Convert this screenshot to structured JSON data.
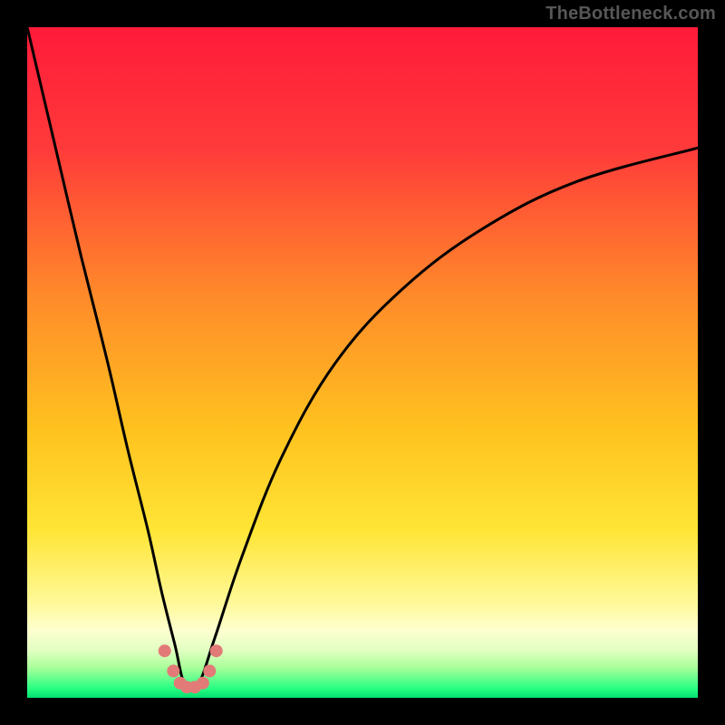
{
  "watermark": "TheBottleneck.com",
  "frame": {
    "outer_w": 800,
    "outer_h": 800,
    "border": 30
  },
  "gradient": {
    "stops": [
      {
        "offset": 0.0,
        "color": "#ff1a3a"
      },
      {
        "offset": 0.18,
        "color": "#ff3a3a"
      },
      {
        "offset": 0.4,
        "color": "#ff8a2a"
      },
      {
        "offset": 0.6,
        "color": "#ffc21f"
      },
      {
        "offset": 0.75,
        "color": "#ffe535"
      },
      {
        "offset": 0.86,
        "color": "#fff99a"
      },
      {
        "offset": 0.9,
        "color": "#fdffd0"
      },
      {
        "offset": 0.93,
        "color": "#e0ffc0"
      },
      {
        "offset": 0.955,
        "color": "#a8ff9a"
      },
      {
        "offset": 0.985,
        "color": "#2dff84"
      },
      {
        "offset": 1.0,
        "color": "#00e070"
      }
    ]
  },
  "chart_data": {
    "type": "line",
    "title": "",
    "xlabel": "",
    "ylabel": "",
    "xlim": [
      0,
      100
    ],
    "ylim": [
      0,
      100
    ],
    "notch_x": 24,
    "series": [
      {
        "name": "curve",
        "x": [
          0,
          4,
          8,
          12,
          15,
          18,
          20,
          22,
          23.5,
          25.5,
          28,
          32,
          38,
          46,
          56,
          68,
          82,
          100
        ],
        "y": [
          100,
          83,
          66,
          50,
          37,
          25,
          16,
          8,
          2,
          2,
          9,
          21,
          36,
          50,
          61,
          70,
          77,
          82
        ]
      }
    ],
    "markers": {
      "name": "bottom-beads",
      "color": "#e27a78",
      "radius": 7,
      "x": [
        20.5,
        21.8,
        22.8,
        23.8,
        25.0,
        26.2,
        27.2,
        28.2
      ],
      "y": [
        7.0,
        4.0,
        2.2,
        1.6,
        1.6,
        2.2,
        4.0,
        7.0
      ]
    }
  }
}
